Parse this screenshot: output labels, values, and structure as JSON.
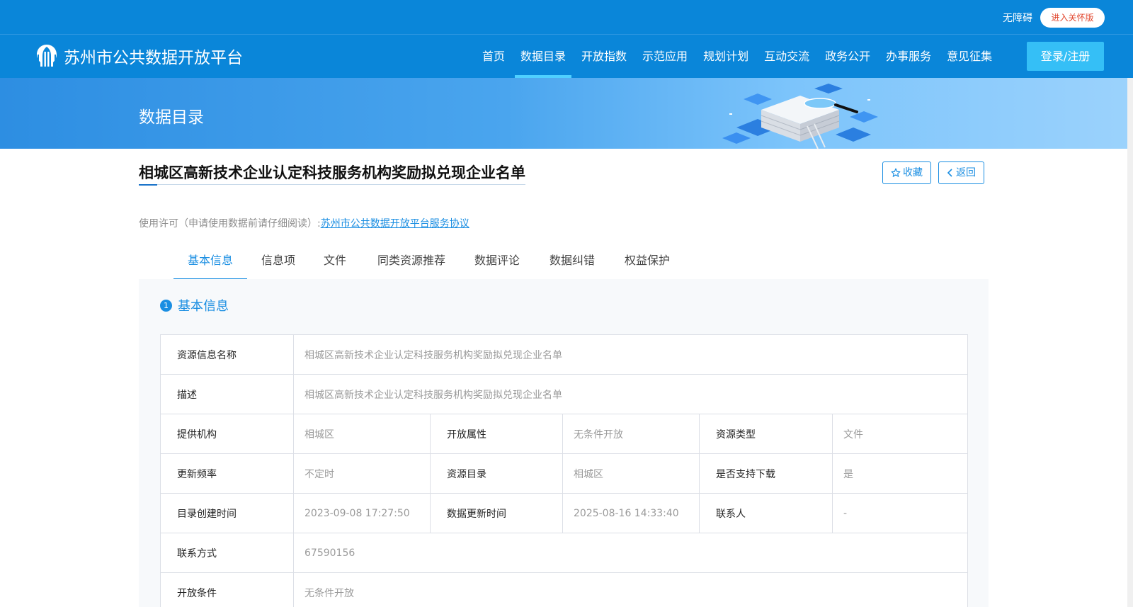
{
  "topbar": {
    "accessibility": "无障碍",
    "care_version": "进入关怀版"
  },
  "nav": {
    "logo_text": "苏州市公共数据开放平台",
    "items": [
      "首页",
      "数据目录",
      "开放指数",
      "示范应用",
      "规划计划",
      "互动交流",
      "政务公开",
      "办事服务",
      "意见征集"
    ],
    "active_index": 1,
    "login": "登录/注册"
  },
  "banner": {
    "title": "数据目录"
  },
  "page": {
    "title": "相城区高新技术企业认定科技服务机构奖励拟兑现企业名单",
    "favorite": "收藏",
    "back": "返回",
    "license_prefix": "使用许可（申请使用数据前请仔细阅读）:",
    "license_link": "苏州市公共数据开放平台服务协议"
  },
  "tabs": [
    "基本信息",
    "信息项",
    "文件",
    "同类资源推荐",
    "数据评论",
    "数据纠错",
    "权益保护"
  ],
  "section": {
    "number": "1",
    "title": "基本信息"
  },
  "info": {
    "resource_name": {
      "label": "资源信息名称",
      "value": "相城区高新技术企业认定科技服务机构奖励拟兑现企业名单"
    },
    "description": {
      "label": "描述",
      "value": "相城区高新技术企业认定科技服务机构奖励拟兑现企业名单"
    },
    "provider": {
      "label": "提供机构",
      "value": "相城区"
    },
    "open_attr": {
      "label": "开放属性",
      "value": "无条件开放"
    },
    "resource_type": {
      "label": "资源类型",
      "value": "文件"
    },
    "update_freq": {
      "label": "更新频率",
      "value": "不定时"
    },
    "catalog": {
      "label": "资源目录",
      "value": "相城区"
    },
    "downloadable": {
      "label": "是否支持下载",
      "value": "是"
    },
    "created": {
      "label": "目录创建时间",
      "value": "2023-09-08 17:27:50"
    },
    "updated": {
      "label": "数据更新时间",
      "value": "2025-08-16 14:33:40"
    },
    "contact": {
      "label": "联系人",
      "value": "-"
    },
    "contact_method": {
      "label": "联系方式",
      "value": "67590156"
    },
    "open_condition": {
      "label": "开放条件",
      "value": "无条件开放"
    }
  },
  "colors": {
    "header_blue": "#0a86d9",
    "accent": "#1a8ee2",
    "login_button": "#35bff6",
    "care_text": "#e1452c"
  }
}
